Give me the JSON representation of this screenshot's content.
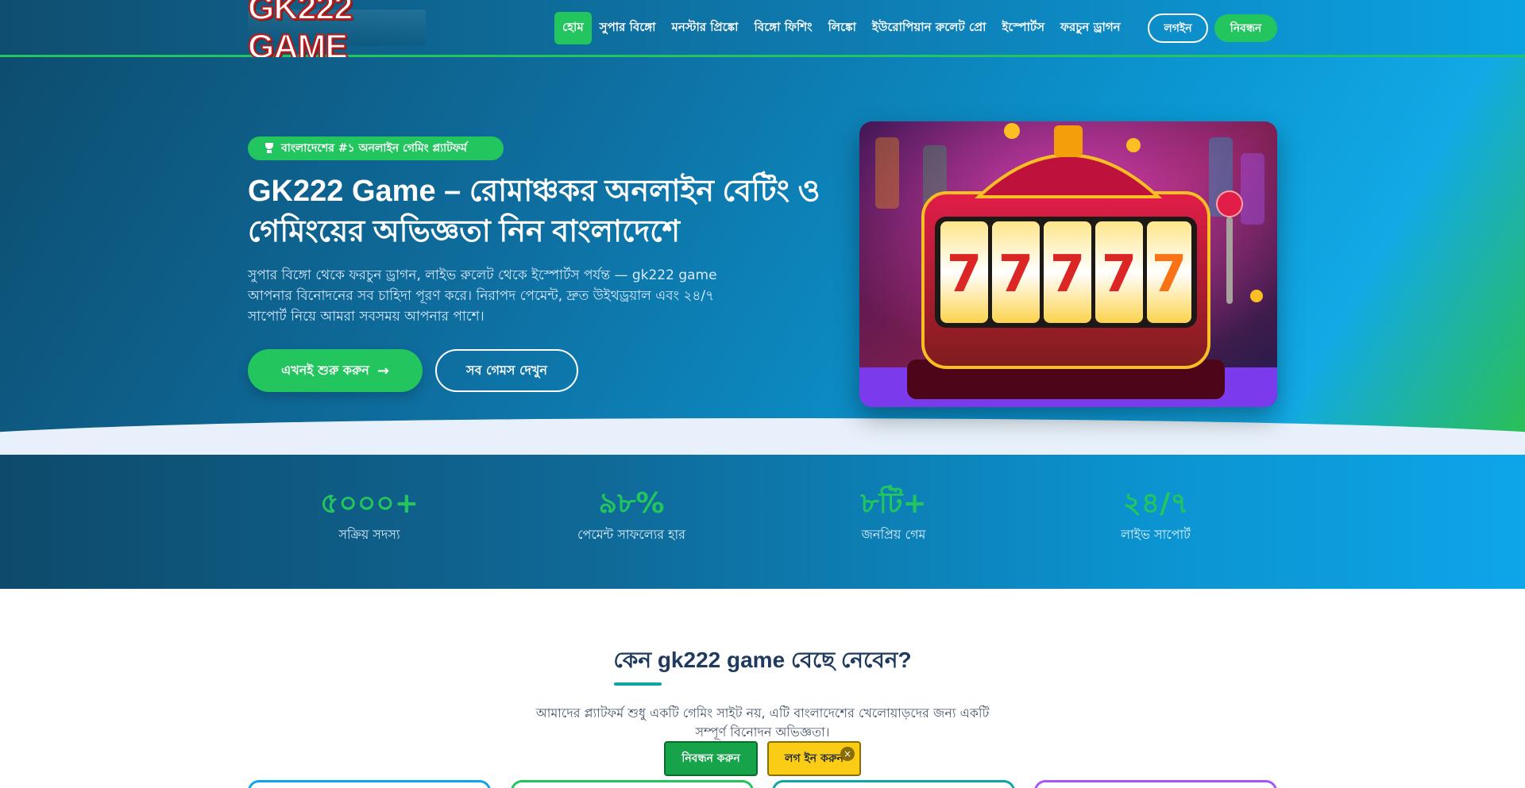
{
  "brand": {
    "logo_text": "GK222 GAME"
  },
  "nav": {
    "items": [
      {
        "label": "হোম",
        "active": true
      },
      {
        "label": "সুপার বিঙ্গো",
        "active": false
      },
      {
        "label": "মনস্টার প্রিঙ্কো",
        "active": false
      },
      {
        "label": "বিঙ্গো ফিশিং",
        "active": false
      },
      {
        "label": "লিঙ্কো",
        "active": false
      },
      {
        "label": "ইউরোপিয়ান রুলেট প্রো",
        "active": false
      },
      {
        "label": "ইস্পোর্টস",
        "active": false
      },
      {
        "label": "ফরচুন ড্রাগন",
        "active": false
      }
    ],
    "login_label": "লগইন",
    "register_label": "নিবন্ধন"
  },
  "hero": {
    "badge": "বাংলাদেশের #১ অনলাইন গেমিং প্ল্যাটফর্ম",
    "title": "GK222 Game – রোমাঞ্চকর অনলাইন বেটিং ও গেমিংয়ের অভিজ্ঞতা নিন বাংলাদেশে",
    "description": "সুপার বিঙ্গো থেকে ফরচুন ড্রাগন, লাইভ রুলেট থেকে ইস্পোর্টস পর্যন্ত — gk222 game আপনার বিনোদনের সব চাহিদা পূরণ করে। নিরাপদ পেমেন্ট, দ্রুত উইথড্রয়াল এবং ২৪/৭ সাপোর্ট নিয়ে আমরা সবসময় আপনার পাশে।",
    "primary_cta": "এখনই শুরু করুন",
    "primary_cta_icon": "arrow-right-icon",
    "secondary_cta": "সব গেমস দেখুন",
    "image_subject": "slot-machine-777"
  },
  "stats": [
    {
      "value": "৫০০০+",
      "label": "সক্রিয় সদস্য"
    },
    {
      "value": "৯৮%",
      "label": "পেমেন্ট সাফল্যের হার"
    },
    {
      "value": "৮টি+",
      "label": "জনপ্রিয় গেম"
    },
    {
      "value": "২৪/৭",
      "label": "লাইভ সাপোর্ট"
    }
  ],
  "why": {
    "title": "কেন gk222 game বেছে নেবেন?",
    "description": "আমাদের প্ল্যাটফর্ম শুধু একটি গেমিং সাইট নয়, এটি বাংলাদেশের খেলোয়াড়দের জন্য একটি সম্পূর্ণ বিনোদন অভিজ্ঞতা।"
  },
  "sticky": {
    "register_label": "নিবন্ধন করুন",
    "login_label": "লগ ইন করুন",
    "close_glyph": "×"
  },
  "colors": {
    "accent_green": "#22c55e",
    "nav_dark": "#0f4e70",
    "nav_light": "#0ba2e3",
    "sticky_yellow": "#facc15",
    "card_colors": [
      "#0ea5e9",
      "#22c55e",
      "#0ea5a4",
      "#a855f7"
    ]
  }
}
